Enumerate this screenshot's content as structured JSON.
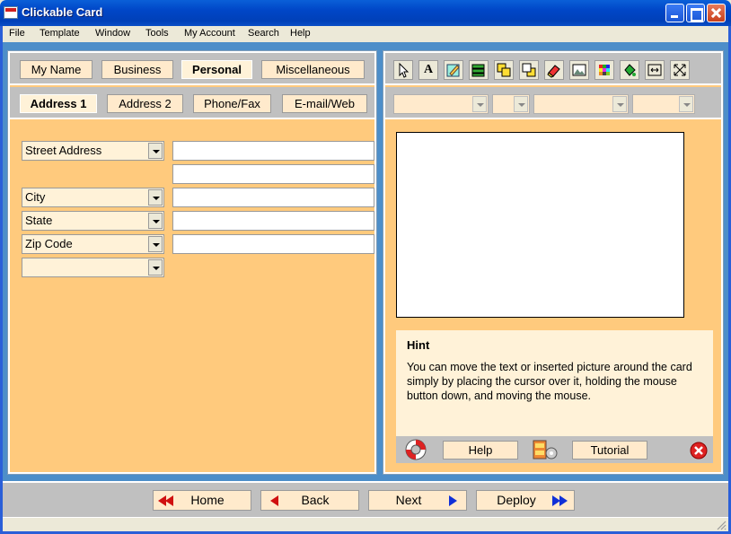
{
  "window": {
    "title": "Clickable Card"
  },
  "menu": [
    "File",
    "Template",
    "Window",
    "Tools",
    "My Account",
    "Search",
    "Help"
  ],
  "main_tabs": [
    {
      "label": "My Name"
    },
    {
      "label": "Business"
    },
    {
      "label": "Personal",
      "active": true
    },
    {
      "label": "Miscellaneous"
    }
  ],
  "sub_tabs": [
    {
      "label": "Address 1",
      "active": true
    },
    {
      "label": "Address 2"
    },
    {
      "label": "Phone/Fax"
    },
    {
      "label": "E-mail/Web"
    }
  ],
  "fields": [
    {
      "label": "Street Address",
      "value": ""
    },
    {
      "label": "",
      "value": ""
    },
    {
      "label": "City",
      "value": ""
    },
    {
      "label": "State",
      "value": ""
    },
    {
      "label": "Zip Code",
      "value": ""
    },
    {
      "label": "",
      "value": ""
    }
  ],
  "toolbar_icons": [
    "pointer-icon",
    "text-icon",
    "edit-icon",
    "layers-icon",
    "bring-forward-icon",
    "send-back-icon",
    "eraser-icon",
    "picture-icon",
    "color-palette-icon",
    "fill-icon",
    "fit-icon",
    "resize-icon"
  ],
  "hint": {
    "title": "Hint",
    "body": "You can move the text or inserted picture around the card simply by placing the cursor over it, holding the mouse button down, and moving the mouse.",
    "help_label": "Help",
    "tutorial_label": "Tutorial"
  },
  "nav": {
    "home": "Home",
    "back": "Back",
    "next": "Next",
    "deploy": "Deploy"
  },
  "colors": {
    "panel": "#ffca7d",
    "tab_bar": "#c0c0c0",
    "frame": "#4d8ec9"
  }
}
